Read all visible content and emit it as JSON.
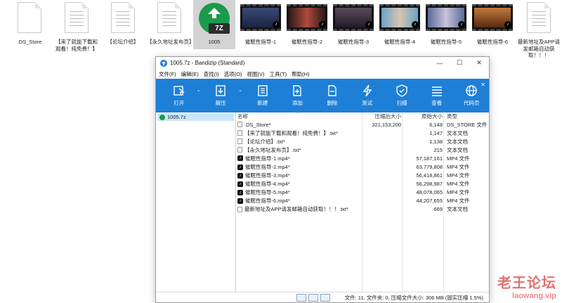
{
  "desktop": {
    "icons": [
      {
        "label": ".DS_Store"
      },
      {
        "label": "【来了就能下载和观看！纯免费！】"
      },
      {
        "label": "【论坛介绍】"
      },
      {
        "label": "【永久地址发布页】"
      },
      {
        "label": "1005",
        "badge": "7Z"
      },
      {
        "label": "催眠性指导-1"
      },
      {
        "label": "催眠性指导-2"
      },
      {
        "label": "催眠性指导-3"
      },
      {
        "label": "催眠性指导-4"
      },
      {
        "label": "催眠性指导-5"
      },
      {
        "label": "催眠性指导-6"
      },
      {
        "label": "最新地址及APP请发邮箱自动获取！！！"
      }
    ]
  },
  "window": {
    "title": "1005.7z - Bandizip (Standard)",
    "menu": [
      "文件(F)",
      "编辑(E)",
      "查找(I)",
      "选项(O)",
      "视图(V)",
      "工具(T)",
      "帮助(H)"
    ],
    "toolbar": [
      "打开",
      "解压",
      "新建",
      "添加",
      "删除",
      "测试",
      "扫描",
      "查看",
      "代码页"
    ],
    "tree_root": "1005.7z",
    "columns": {
      "name": "名称",
      "compressed": "压缩后大小",
      "original": "原始大小",
      "type": "类型"
    },
    "files": [
      {
        "name": ".DS_Store*",
        "compressed": "321,153,200",
        "original": "6,148",
        "type": "DS_STORE 文件",
        "kind": "file"
      },
      {
        "name": "【来了就能下载和观看！纯免费！】.txt*",
        "compressed": "",
        "original": "1,147",
        "type": "文本文档",
        "kind": "file"
      },
      {
        "name": "【论坛介绍】.txt*",
        "compressed": "",
        "original": "1,138",
        "type": "文本文档",
        "kind": "file"
      },
      {
        "name": "【永久地址发布页】.txt*",
        "compressed": "",
        "original": "215",
        "type": "文本文档",
        "kind": "file"
      },
      {
        "name": "催眠性指导-1.mp4*",
        "compressed": "",
        "original": "57,187,161",
        "type": "MP4 文件",
        "kind": "mp4"
      },
      {
        "name": "催眠性指导-2.mp4*",
        "compressed": "",
        "original": "63,779,808",
        "type": "MP4 文件",
        "kind": "mp4"
      },
      {
        "name": "催眠性指导-3.mp4*",
        "compressed": "",
        "original": "56,418,861",
        "type": "MP4 文件",
        "kind": "mp4"
      },
      {
        "name": "催眠性指导-4.mp4*",
        "compressed": "",
        "original": "56,298,987",
        "type": "MP4 文件",
        "kind": "mp4"
      },
      {
        "name": "催眠性指导-5.mp4*",
        "compressed": "",
        "original": "48,078,065",
        "type": "MP4 文件",
        "kind": "mp4"
      },
      {
        "name": "催眠性指导-6.mp4*",
        "compressed": "",
        "original": "44,207,655",
        "type": "MP4 文件",
        "kind": "mp4"
      },
      {
        "name": "最新地址及APP请发邮箱自动获取！！！.txt*",
        "compressed": "",
        "original": "669",
        "type": "文本文档",
        "kind": "file"
      }
    ],
    "status": "文件: 11, 文件夹: 0, 压缩文件大小: 306 MB (固实压缩 1.5%)"
  },
  "watermark": {
    "line1": "老王论坛",
    "line2": "laowang.vip"
  },
  "colors": {
    "accent": "#1e7fd7",
    "selection": "#cce6ff",
    "bandizip_green": "#1b9a4c"
  }
}
